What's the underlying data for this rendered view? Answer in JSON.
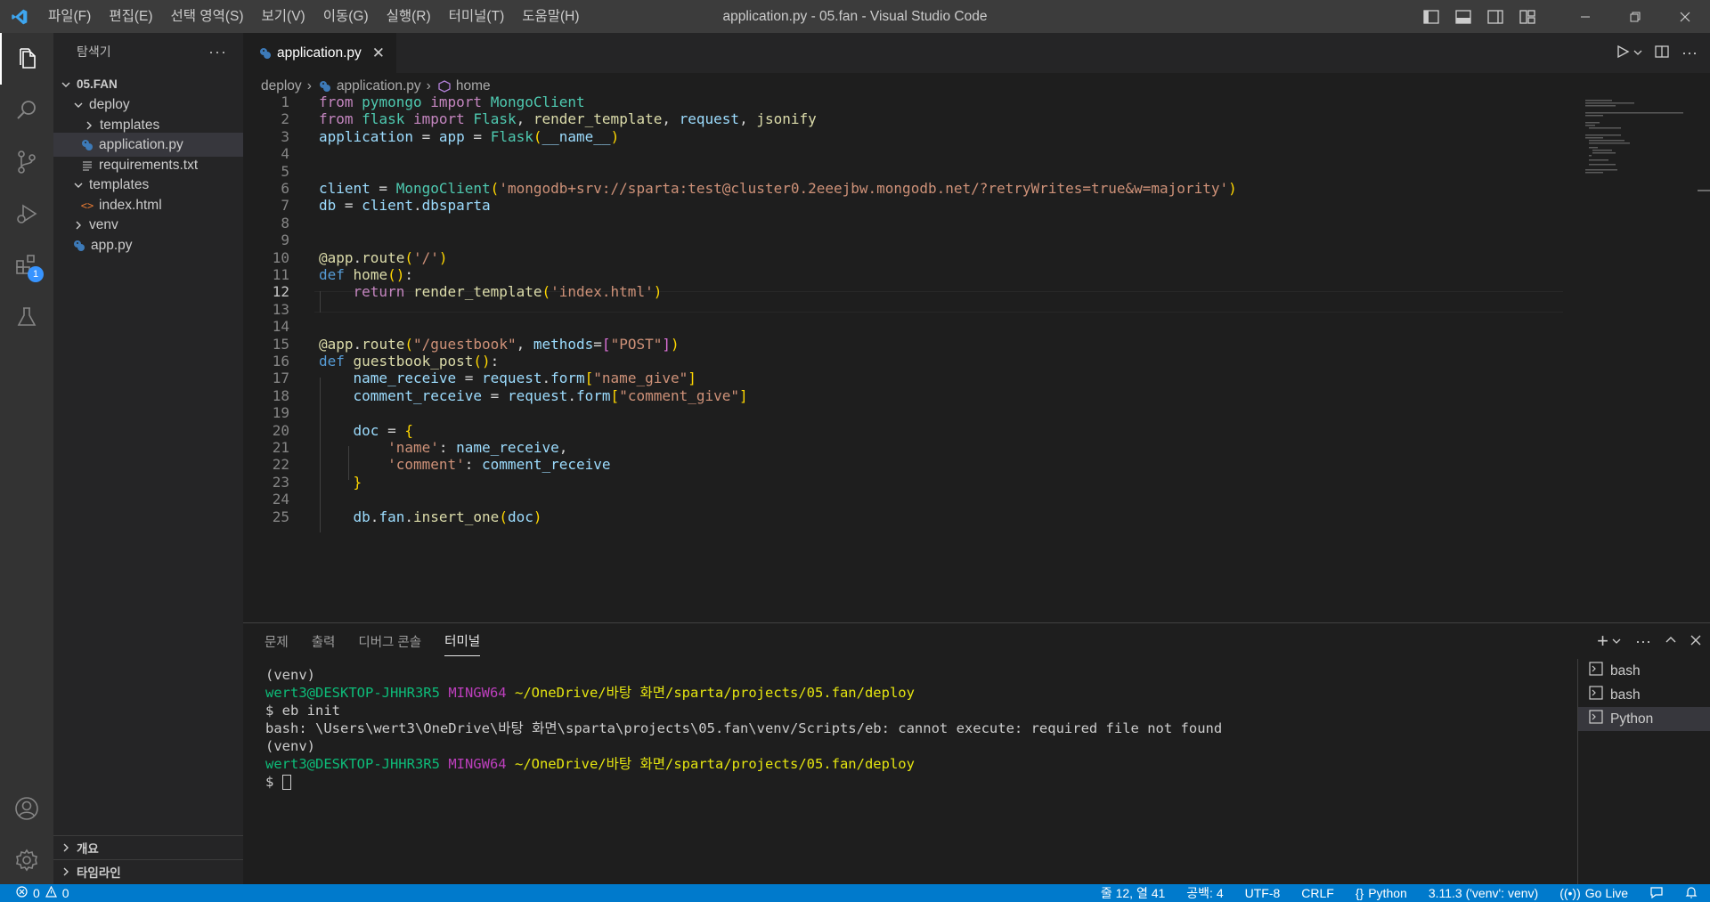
{
  "window": {
    "title": "application.py - 05.fan - Visual Studio Code",
    "menu": [
      "파일(F)",
      "편집(E)",
      "선택 영역(S)",
      "보기(V)",
      "이동(G)",
      "실행(R)",
      "터미널(T)",
      "도움말(H)"
    ]
  },
  "activity": {
    "extensions_badge": "1"
  },
  "explorer": {
    "title": "탐색기",
    "root": "05.FAN",
    "items": [
      "deploy",
      "templates",
      "application.py",
      "requirements.txt",
      "templates",
      "index.html",
      "venv",
      "app.py"
    ],
    "outline": "개요",
    "timeline": "타임라인"
  },
  "editor": {
    "tab": "application.py",
    "breadcrumbs": [
      "deploy",
      "application.py",
      "home"
    ],
    "line_numbers": [
      "1",
      "2",
      "3",
      "4",
      "5",
      "6",
      "7",
      "8",
      "9",
      "10",
      "11",
      "12",
      "13",
      "14",
      "15",
      "16",
      "17",
      "18",
      "19",
      "20",
      "21",
      "22",
      "23",
      "24",
      "25"
    ],
    "current_line": "12",
    "code": [
      "from pymongo import MongoClient",
      "from flask import Flask, render_template, request, jsonify",
      "application = app = Flask(__name__)",
      "",
      "",
      "client = MongoClient('mongodb+srv://sparta:test@cluster0.2eeejbw.mongodb.net/?retryWrites=true&w=majority')",
      "db = client.dbsparta",
      "",
      "",
      "@app.route('/')",
      "def home():",
      "    return render_template('index.html')",
      "",
      "",
      "@app.route(\"/guestbook\", methods=[\"POST\"])",
      "def guestbook_post():",
      "    name_receive = request.form[\"name_give\"]",
      "    comment_receive = request.form[\"comment_give\"]",
      "",
      "    doc = {",
      "        'name': name_receive,",
      "        'comment': comment_receive",
      "    }",
      "",
      "    db.fan.insert_one(doc)"
    ]
  },
  "panel": {
    "tabs": [
      "문제",
      "출력",
      "디버그 콘솔",
      "터미널"
    ],
    "active_tab": "터미널",
    "terminal": {
      "venv": "(venv)",
      "user": "wert3@DESKTOP-JHHR3R5",
      "shell": "MINGW64",
      "path": "~/OneDrive/바탕 화면/sparta/projects/05.fan/deploy",
      "command": "$ eb init",
      "error": "bash: \\Users\\wert3\\OneDrive\\바탕 화면\\sparta\\projects\\05.fan\\venv/Scripts/eb: cannot execute: required file not found",
      "prompt": "$ "
    },
    "terminals": [
      "bash",
      "bash",
      "Python"
    ]
  },
  "status": {
    "errors": "0",
    "warnings": "0",
    "position": "줄 12, 열 41",
    "spaces": "공백: 4",
    "encoding": "UTF-8",
    "eol": "CRLF",
    "language": "Python",
    "interpreter": "3.11.3 ('venv': venv)",
    "golive": "Go Live"
  },
  "colors": {
    "accent": "#007acc",
    "titlebar": "#3c3c3c",
    "editor_bg": "#1e1e1e"
  }
}
